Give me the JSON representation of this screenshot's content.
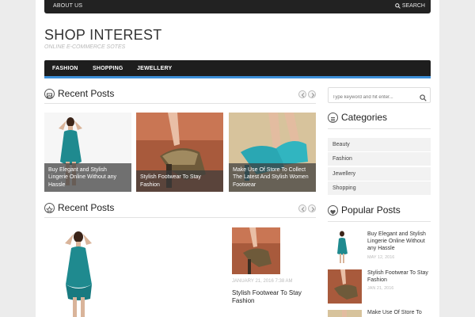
{
  "topbar": {
    "about": "ABOUT US",
    "search": "SEARCH"
  },
  "site": {
    "title": "SHOP INTEREST",
    "tagline": "ONLINE E-COMMERCE SOTES"
  },
  "nav": {
    "items": [
      "FASHION",
      "SHOPPING",
      "JEWELLERY"
    ]
  },
  "slider": {
    "heading": "Recent Posts",
    "cards": [
      {
        "caption": "Buy Elegant and Stylish Lingerie Online Without any Hassle"
      },
      {
        "caption": "Stylish Footwear To Stay Fashion"
      },
      {
        "caption": "Make Use Of Store To Collect The Latest And Stylish Women Footwear"
      }
    ]
  },
  "search": {
    "placeholder": "Type keyword and hit enter..."
  },
  "categories": {
    "heading": "Categories",
    "items": [
      "Beauty",
      "Fashion",
      "Jewellery",
      "Shopping"
    ]
  },
  "latest": {
    "heading": "Recent Posts",
    "post": {
      "date": "JANUARY 21, 2016 7:38 AM",
      "title": "Stylish Footwear To Stay Fashion"
    }
  },
  "popular": {
    "heading": "Popular Posts",
    "items": [
      {
        "title": "Buy Elegant and Stylish Lingerie Online Without any Hassle",
        "date": "MAY 12, 2016"
      },
      {
        "title": "Stylish Footwear To Stay Fashion",
        "date": "JAN 21, 2016"
      },
      {
        "title": "Make Use Of Store To",
        "date": ""
      }
    ]
  },
  "colors": {
    "accent": "#3d8fd8",
    "nav_bg": "#1e1e1e"
  }
}
